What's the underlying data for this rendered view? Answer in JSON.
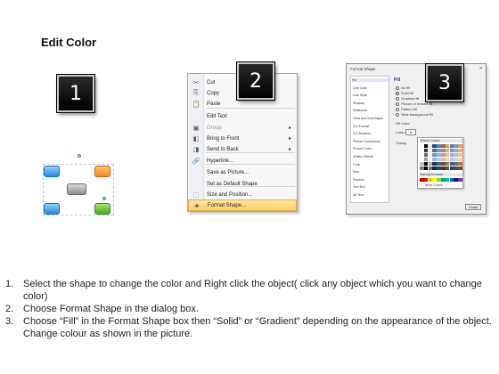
{
  "title": "Edit Color",
  "badges": [
    "1",
    "2",
    "3"
  ],
  "context_menu": {
    "items": [
      {
        "icon": "✂",
        "label": "Cut",
        "dim": false,
        "arrow": false
      },
      {
        "icon": "⎘",
        "label": "Copy",
        "dim": false,
        "arrow": false
      },
      {
        "icon": "📋",
        "label": "Paste",
        "dim": false,
        "arrow": false
      },
      {
        "icon": "",
        "label": "Edit Text",
        "dim": false,
        "arrow": false
      },
      {
        "icon": "▣",
        "label": "Group",
        "dim": true,
        "arrow": true
      },
      {
        "icon": "◧",
        "label": "Bring to Front",
        "dim": false,
        "arrow": true
      },
      {
        "icon": "◨",
        "label": "Send to Back",
        "dim": false,
        "arrow": true
      },
      {
        "icon": "🔗",
        "label": "Hyperlink...",
        "dim": false,
        "arrow": false
      },
      {
        "icon": "",
        "label": "Save as Picture...",
        "dim": false,
        "arrow": false
      },
      {
        "icon": "",
        "label": "Set as Default Shape",
        "dim": false,
        "arrow": false
      },
      {
        "icon": "⬚",
        "label": "Size and Position...",
        "dim": false,
        "arrow": false
      },
      {
        "icon": "◈",
        "label": "Format Shape...",
        "dim": false,
        "arrow": false
      }
    ]
  },
  "dialog": {
    "title": "Format Shape",
    "close": "✕",
    "nav": [
      "Fill",
      "Line Color",
      "Line Style",
      "Shadow",
      "Reflection",
      "Glow and Soft Edges",
      "3-D Format",
      "3-D Rotation",
      "Picture Corrections",
      "Picture Color",
      "Artistic Effects",
      "Crop",
      "Size",
      "Position",
      "Text Box",
      "Alt Text"
    ],
    "section": "Fill",
    "options": [
      "No fill",
      "Solid fill",
      "Gradient fill",
      "Picture or texture fill",
      "Pattern fill",
      "Slide background fill"
    ],
    "fill_color_label": "Fill Color",
    "color_label": "Color:",
    "transparency_label": "Transp",
    "theme_colors": "Theme Colors",
    "standard_colors": "Standard Colors",
    "more_colors": "More Colors...",
    "close_button": "Close"
  },
  "theme_colors": [
    "#ffffff",
    "#000000",
    "#eeece1",
    "#1f497d",
    "#4f81bd",
    "#c0504d",
    "#9bbb59",
    "#8064a2",
    "#4bacc6",
    "#f79646"
  ],
  "standard_colors": [
    "#c00000",
    "#ff0000",
    "#ffc000",
    "#ffff00",
    "#92d050",
    "#00b050",
    "#00b0f0",
    "#0070c0",
    "#002060",
    "#7030a0"
  ],
  "instructions": [
    {
      "num": "1.",
      "text": "Select the shape to change the color and Right click the object( click any object which you want to change color)"
    },
    {
      "num": "2.",
      "text": "Choose Format Shape in the dialog box."
    },
    {
      "num": "3.",
      "text": "Choose “Fill” in the Format Shape box then “Solid” or “Gradient” depending on the appearance of the object. Change colour as shown in the picture."
    }
  ]
}
